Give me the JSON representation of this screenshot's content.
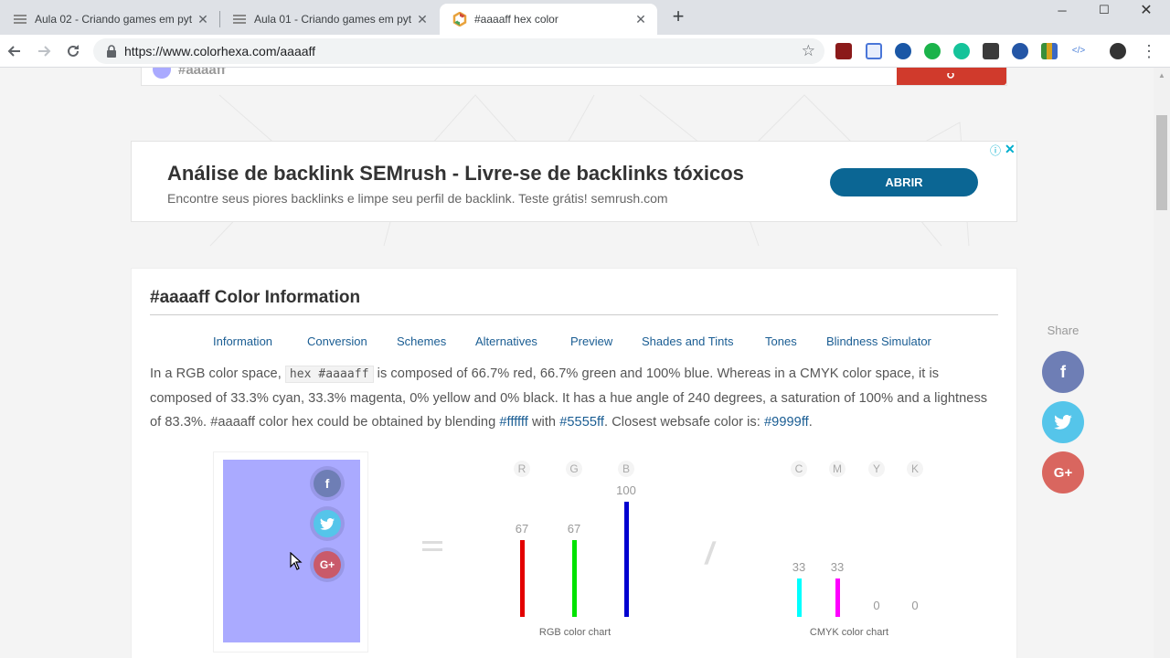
{
  "browser": {
    "tabs": [
      {
        "title": "Aula 02 - Criando games em pyt",
        "active": false
      },
      {
        "title": "Aula 01 - Criando games em pyt",
        "active": false
      },
      {
        "title": "#aaaaff hex color",
        "active": true
      }
    ],
    "url": "https://www.colorhexa.com/aaaaff"
  },
  "search": {
    "value": "#aaaaff"
  },
  "ad": {
    "headline": "Análise de backlink SEMrush - Livre-se de backlinks tóxicos",
    "description": "Encontre seus piores backlinks e limpe seu perfil de backlink. Teste grátis! semrush.com",
    "cta": "ABRIR"
  },
  "card": {
    "title": "#aaaaff Color Information",
    "nav": [
      "Information",
      "Conversion",
      "Schemes",
      "Alternatives",
      "Preview",
      "Shades and Tints",
      "Tones",
      "Blindness Simulator"
    ],
    "paragraph": {
      "p1": "In a RGB color space, ",
      "code": "hex #aaaaff",
      "p2": " is composed of 66.7% red, 66.7% green and 100% blue. Whereas in a CMYK color space, it is composed of 33.3% cyan, 33.3% magenta, 0% yellow and 0% black. It has a hue angle of 240 degrees, a saturation of 100% and a lightness of 83.3%. #aaaaff color hex could be obtained by blending ",
      "link1": "#ffffff",
      "p3": " with ",
      "link2": "#5555ff",
      "p4": ". Closest websafe color is: ",
      "link3": "#9999ff",
      "p5": "."
    },
    "swatch_color": "#aaaaff"
  },
  "chart_data": [
    {
      "type": "bar",
      "title": "RGB color chart",
      "categories": [
        "R",
        "G",
        "B"
      ],
      "values": [
        67,
        67,
        100
      ],
      "colors": [
        "#e30000",
        "#00e300",
        "#0000d0"
      ],
      "ylim": [
        0,
        100
      ]
    },
    {
      "type": "bar",
      "title": "CMYK color chart",
      "categories": [
        "C",
        "M",
        "Y",
        "K"
      ],
      "values": [
        33,
        33,
        0,
        0
      ],
      "colors": [
        "#00ffff",
        "#ff00ff",
        "#ffff00",
        "#000000"
      ],
      "ylim": [
        0,
        100
      ]
    }
  ],
  "share": {
    "label": "Share",
    "buttons": [
      {
        "icon": "facebook-icon",
        "glyph": "f",
        "color": "#6e7eb5"
      },
      {
        "icon": "twitter-icon",
        "glyph": "t",
        "color": "#55c5ea"
      },
      {
        "icon": "google-plus-icon",
        "glyph": "G+",
        "color": "#d9665f"
      }
    ]
  }
}
